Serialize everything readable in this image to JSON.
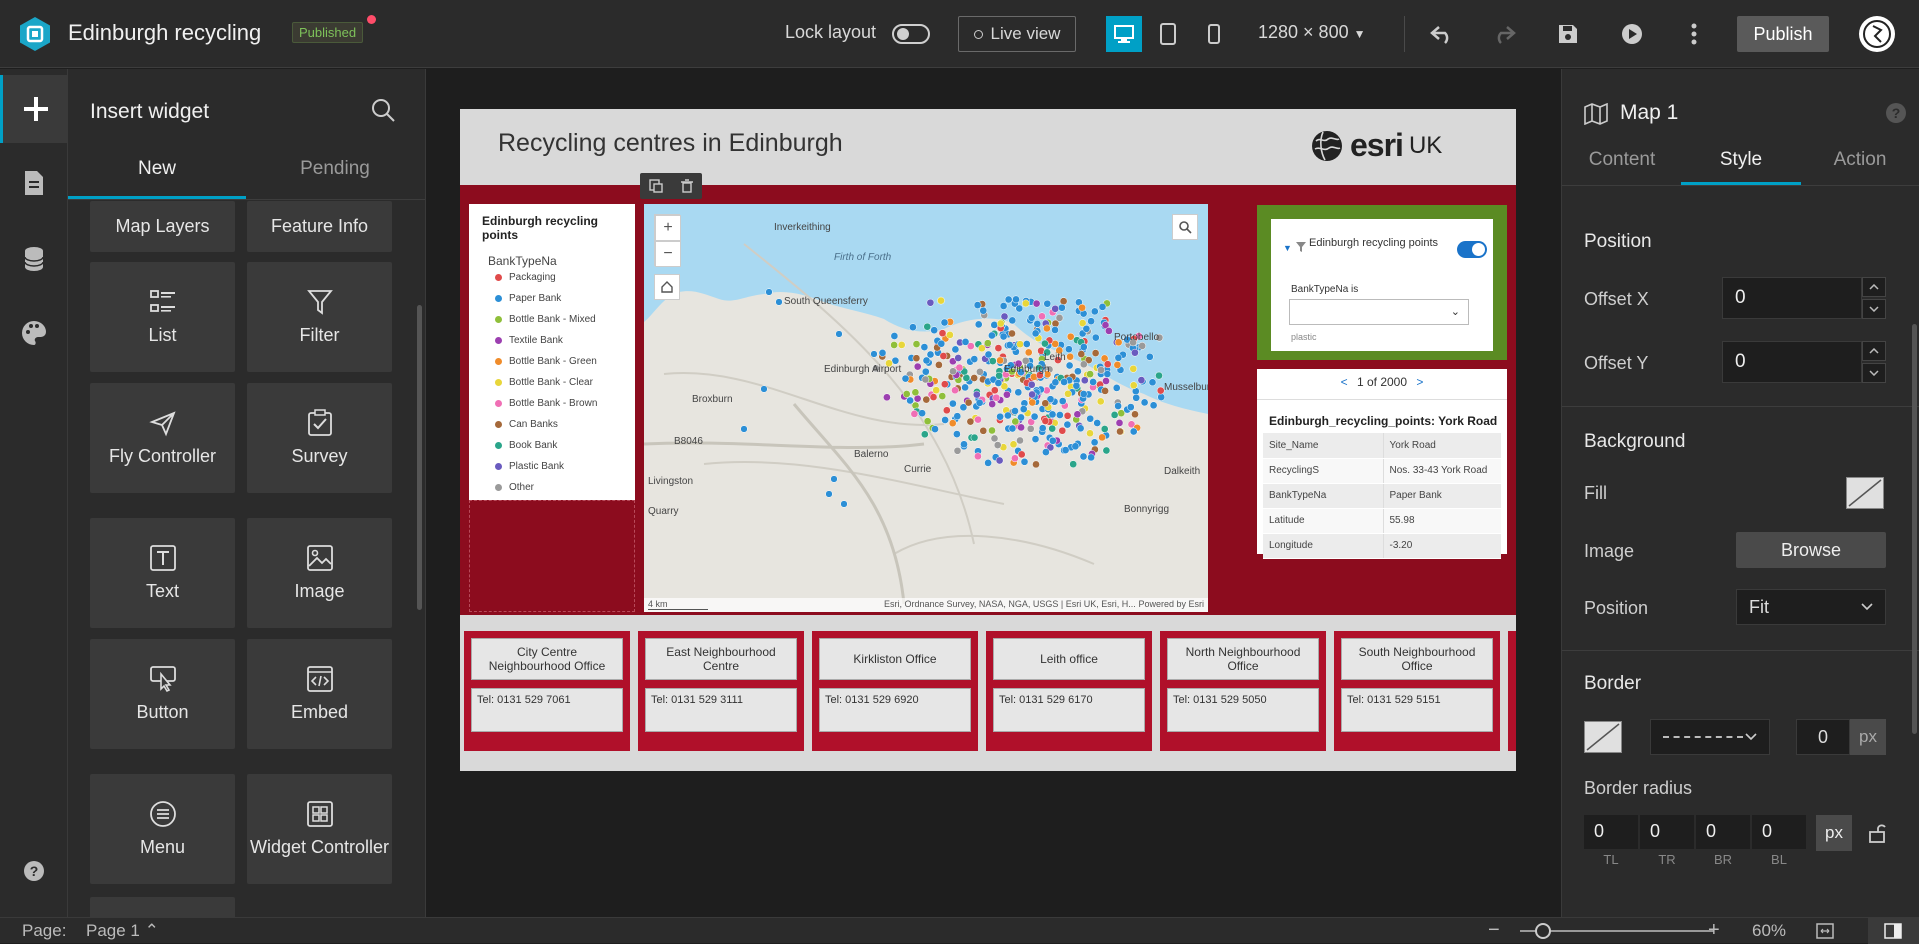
{
  "header": {
    "app_title": "Edinburgh recycling",
    "status_badge": "Published",
    "lock_layout_label": "Lock layout",
    "live_view_label": "Live view",
    "resolution": "1280 × 800",
    "publish_label": "Publish"
  },
  "insert_panel": {
    "title": "Insert widget",
    "tabs": [
      "New",
      "Pending"
    ],
    "widgets": [
      "Map Layers",
      "Feature Info",
      "List",
      "Filter",
      "Fly Controller",
      "Survey",
      "Text",
      "Image",
      "Button",
      "Embed",
      "Menu",
      "Widget Controller"
    ]
  },
  "page": {
    "title": "Recycling centres in Edinburgh",
    "logo_text": "esri",
    "logo_suffix": "UK",
    "legend": {
      "title": "Edinburgh recycling points",
      "field": "BankTypeNa",
      "items": [
        {
          "label": "Packaging",
          "color": "#e04b4b"
        },
        {
          "label": "Paper Bank",
          "color": "#2c8fd6"
        },
        {
          "label": "Bottle Bank - Mixed",
          "color": "#8fbf3a"
        },
        {
          "label": "Textile Bank",
          "color": "#9c3fb0"
        },
        {
          "label": "Bottle Bank - Green",
          "color": "#f08c2a"
        },
        {
          "label": "Bottle Bank - Clear",
          "color": "#e8d63a"
        },
        {
          "label": "Bottle Bank - Brown",
          "color": "#f06fb5"
        },
        {
          "label": "Can Banks",
          "color": "#a5693a"
        },
        {
          "label": "Book Bank",
          "color": "#2aa58a"
        },
        {
          "label": "Plastic Bank",
          "color": "#6a5bbf"
        },
        {
          "label": "Other",
          "color": "#9a9a9a"
        }
      ]
    },
    "map": {
      "labels": [
        "Inverkeithing",
        "Firth of Forth",
        "South Queensferry",
        "Edinburgh Airport",
        "Broxburn",
        "Edinburgh",
        "Leith",
        "Portobello",
        "Musselburgh",
        "Currie",
        "Dalkeith",
        "Bonnyrigg",
        "Livingston",
        "Quarry",
        "B8046",
        "Balerno"
      ],
      "scale": "4 km",
      "attribution": "Esri, Ordnance Survey, NASA, NGA, USGS | Esri UK, Esri, H...",
      "powered_by": "Powered by Esri"
    },
    "filter": {
      "layer_title": "Edinburgh recycling points",
      "condition_label": "BankTypeNa is",
      "placeholder": "plastic"
    },
    "feature_info": {
      "pager": "1 of 2000",
      "prev": "<",
      "next": ">",
      "title": "Edinburgh_recycling_points: York Road",
      "rows": [
        {
          "field": "Site_Name",
          "value": "York Road"
        },
        {
          "field": "RecyclingS",
          "value": "Nos. 33-43 York Road"
        },
        {
          "field": "BankTypeNa",
          "value": "Paper Bank"
        },
        {
          "field": "Latitude",
          "value": "55.98"
        },
        {
          "field": "Longitude",
          "value": "-3.20"
        }
      ]
    },
    "offices": [
      {
        "name": "City Centre Neighbourhood Office",
        "tel": "Tel: 0131 529 7061"
      },
      {
        "name": "East Neighbourhood Centre",
        "tel": "Tel: 0131 529 3111"
      },
      {
        "name": "Kirkliston Office",
        "tel": "Tel: 0131 529 6920"
      },
      {
        "name": "Leith office",
        "tel": "Tel: 0131 529 6170"
      },
      {
        "name": "North Neighbourhood Office",
        "tel": "Tel: 0131 529 5050"
      },
      {
        "name": "South Neighbourhood Office",
        "tel": "Tel: 0131 529 5151"
      }
    ]
  },
  "right_panel": {
    "title": "Map 1",
    "tabs": [
      "Content",
      "Style",
      "Action"
    ],
    "position_heading": "Position",
    "offset_x_label": "Offset X",
    "offset_x_value": "0",
    "offset_y_label": "Offset Y",
    "offset_y_value": "0",
    "background_heading": "Background",
    "fill_label": "Fill",
    "image_label": "Image",
    "browse_label": "Browse",
    "position_label": "Position",
    "position_value": "Fit",
    "border_heading": "Border",
    "border_width": "0",
    "border_unit": "px",
    "border_radius_heading": "Border radius",
    "radius_values": [
      "0",
      "0",
      "0",
      "0"
    ],
    "radius_unit": "px",
    "radius_labels": [
      "TL",
      "TR",
      "BR",
      "BL"
    ]
  },
  "bottom_bar": {
    "page_label": "Page:",
    "page_value": "Page 1",
    "zoom": "60%"
  },
  "colors": {
    "accent": "#00a0c6",
    "maroon": "#8c0c1e",
    "filter_green": "#5b8b23"
  }
}
